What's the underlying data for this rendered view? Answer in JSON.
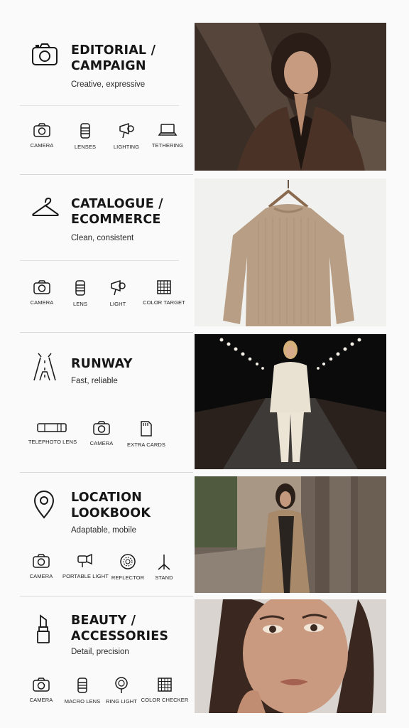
{
  "sections": [
    {
      "title_line1": "EDITORIAL /",
      "title_line2": "CAMPAIGN",
      "subtitle": "Creative, expressive",
      "head_icon": "camera-icon",
      "equipment": [
        {
          "label": "CAMERA",
          "icon": "camera-icon"
        },
        {
          "label": "LENSES",
          "icon": "lens-icon"
        },
        {
          "label": "LIGHTING",
          "icon": "spotlight-icon"
        },
        {
          "label": "TETHERING",
          "icon": "laptop-icon"
        }
      ],
      "photo": "woman-brown-blazer-photo"
    },
    {
      "title_line1": "CATALOGUE /",
      "title_line2": "ECOMMERCE",
      "subtitle": "Clean, consistent",
      "head_icon": "hanger-icon",
      "equipment": [
        {
          "label": "CAMERA",
          "icon": "camera-icon"
        },
        {
          "label": "LENS",
          "icon": "lens-icon"
        },
        {
          "label": "LIGHT",
          "icon": "spotlight-icon"
        },
        {
          "label": "COLOR TARGET",
          "icon": "grid-target-icon"
        }
      ],
      "photo": "beige-sweater-photo"
    },
    {
      "title_line1": "RUNWAY",
      "title_line2": "",
      "subtitle": "Fast, reliable",
      "head_icon": "runway-icon",
      "equipment": [
        {
          "label": "TELEPHOTO LENS",
          "icon": "telephoto-lens-icon"
        },
        {
          "label": "CAMERA",
          "icon": "camera-icon"
        },
        {
          "label": "EXTRA CARDS",
          "icon": "memory-card-icon"
        }
      ],
      "photo": "runway-model-photo"
    },
    {
      "title_line1": "LOCATION",
      "title_line2": "LOOKBOOK",
      "subtitle": "Adaptable, mobile",
      "head_icon": "location-pin-icon",
      "equipment": [
        {
          "label": "CAMERA",
          "icon": "camera-icon"
        },
        {
          "label": "PORTABLE LIGHT",
          "icon": "portable-light-icon"
        },
        {
          "label": "REFLECTOR",
          "icon": "reflector-icon"
        },
        {
          "label": "STAND",
          "icon": "light-stand-icon"
        }
      ],
      "photo": "trench-coat-street-photo"
    },
    {
      "title_line1": "BEAUTY /",
      "title_line2": "ACCESSORIES",
      "subtitle": "Detail, precision",
      "head_icon": "lipstick-icon",
      "equipment": [
        {
          "label": "CAMERA",
          "icon": "camera-icon"
        },
        {
          "label": "MACRO LENS",
          "icon": "lens-icon"
        },
        {
          "label": "RING LIGHT",
          "icon": "ring-light-icon"
        },
        {
          "label": "COLOR CHECKER",
          "icon": "grid-target-icon"
        }
      ],
      "photo": "beauty-closeup-photo"
    }
  ]
}
